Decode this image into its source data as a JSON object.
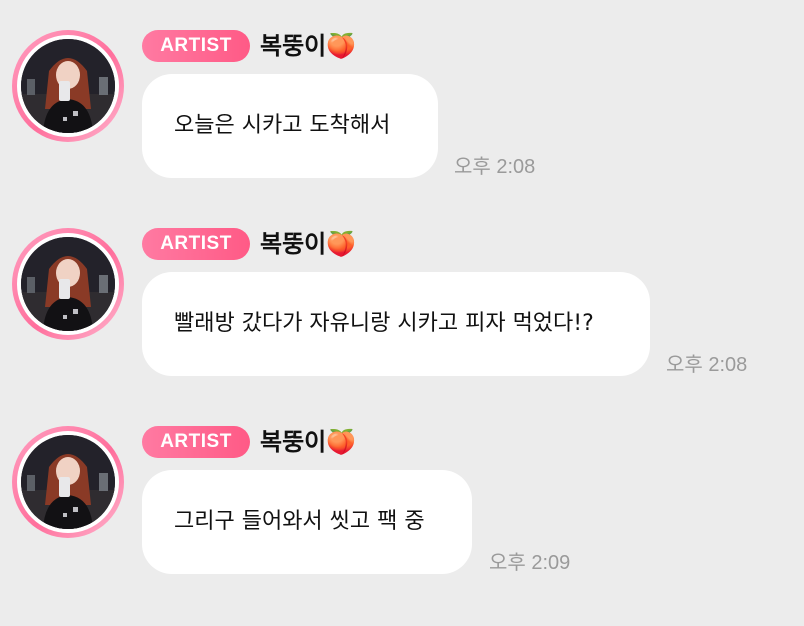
{
  "messages": [
    {
      "badge": "ARTIST",
      "name": "복뚱이",
      "emoji": "🍑",
      "text": "오늘은 시카고 도착해서",
      "time": "오후 2:08",
      "avatar_icon": "profile-avatar"
    },
    {
      "badge": "ARTIST",
      "name": "복뚱이",
      "emoji": "🍑",
      "text": "빨래방 갔다가 자유니랑 시카고 피자 먹었다!?",
      "time": "오후 2:08",
      "avatar_icon": "profile-avatar"
    },
    {
      "badge": "ARTIST",
      "name": "복뚱이",
      "emoji": "🍑",
      "text": "그리구 들어와서 씻고 팩 중",
      "time": "오후 2:09",
      "avatar_icon": "profile-avatar"
    }
  ],
  "colors": {
    "background": "#ececec",
    "badge": "#ff6a92",
    "avatar_ring": "#ff7fa6",
    "bubble": "#ffffff",
    "time": "#9a9a9a"
  }
}
